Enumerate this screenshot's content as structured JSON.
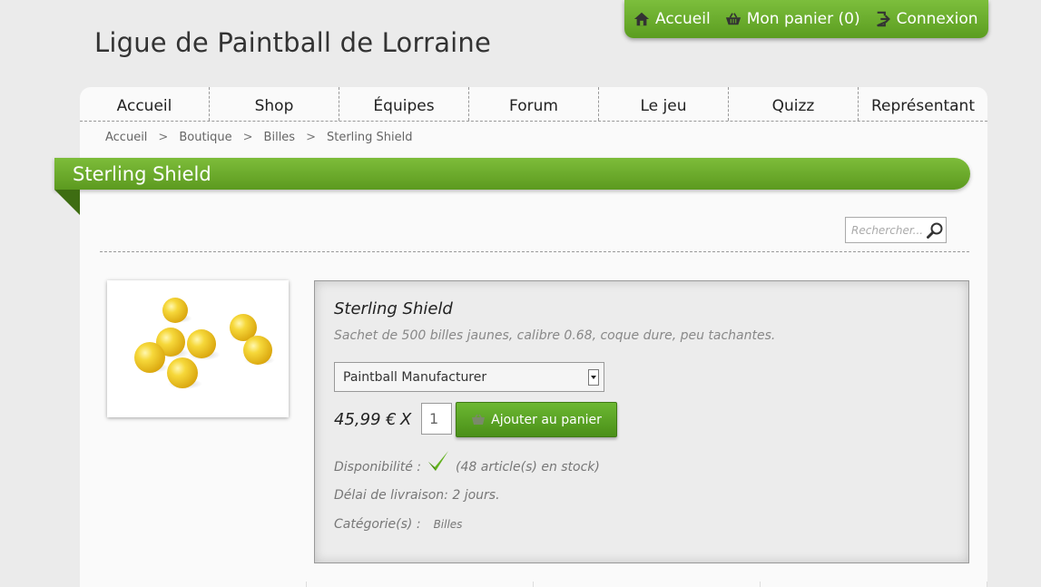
{
  "site": {
    "title": "Ligue de Paintball de Lorraine"
  },
  "user_bar": {
    "home_label": "Accueil",
    "cart_label": "Mon panier (0)",
    "login_label": "Connexion"
  },
  "nav": {
    "items": [
      {
        "label": "Accueil"
      },
      {
        "label": "Shop"
      },
      {
        "label": "Équipes"
      },
      {
        "label": "Forum"
      },
      {
        "label": "Le jeu"
      },
      {
        "label": "Quizz"
      },
      {
        "label": "Représentant"
      }
    ]
  },
  "breadcrumb": {
    "items": [
      "Accueil",
      "Boutique",
      "Billes",
      "Sterling Shield"
    ],
    "separator": ">"
  },
  "page": {
    "title": "Sterling Shield"
  },
  "search": {
    "placeholder": "Rechercher..."
  },
  "product": {
    "name": "Sterling Shield",
    "description": "Sachet de 500 billes jaunes, calibre 0.68, coque dure, peu tachantes.",
    "manufacturer_selected": "Paintball Manufacturer",
    "price": "45,99 €",
    "times": "X",
    "quantity": "1",
    "add_to_cart_label": "Ajouter au panier",
    "availability_label": "Disponibilité :",
    "availability_stock": "(48 article(s) en stock)",
    "delivery": "Délai de livraison: 2 jours.",
    "category_label": "Catégorie(s) :",
    "category_value": "Billes"
  },
  "colors": {
    "accent_green": "#6cb832",
    "background": "#ebebeb"
  },
  "icons": {
    "home": "home-icon",
    "cart": "basket-icon",
    "login": "login-icon",
    "search": "magnifier-icon",
    "check": "check-icon"
  }
}
